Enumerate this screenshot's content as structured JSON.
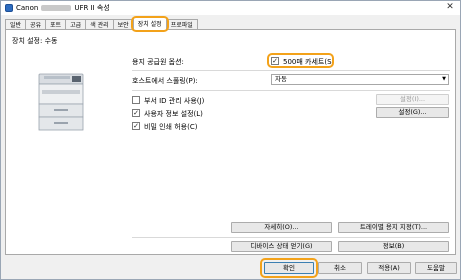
{
  "titlebar": {
    "brand": "Canon",
    "title_suffix": "UFR II 속성",
    "close_glyph": "✕"
  },
  "tabs": [
    "일반",
    "공유",
    "포트",
    "고급",
    "색 관리",
    "보안",
    "장치 설정",
    "프로파일"
  ],
  "active_tab": "장치 설정",
  "panel": {
    "device_settings_label": "장치 설정: 수동",
    "paper_source_label": "용지 공급원 옵션:",
    "paper_source_value": "500매 카세트(S)",
    "host_spooling_label": "호스트에서 스풀링(P):",
    "host_spooling_value": "자동",
    "dept_id_label": "부서 ID 관리 사용(J)",
    "dept_id_checked": false,
    "settings_button": "설정(I)...",
    "user_info_label": "사용자 정보 설정(L)",
    "user_info_checked": true,
    "user_settings_button": "설정(G)...",
    "secure_print_label": "비밀 인쇄 허용(C)",
    "secure_print_checked": true,
    "details_button": "자세히(O)...",
    "tray_settings_button": "트레이별 용지 지정(T)...",
    "device_status_button": "디바이스 상태 얻기(G)",
    "info_button": "정보(B)"
  },
  "footer": {
    "ok": "확인",
    "cancel": "취소",
    "apply": "적용(A)",
    "help": "도움말"
  },
  "colors": {
    "highlight": "#f3a21a",
    "accent": "#2d6cc0"
  }
}
